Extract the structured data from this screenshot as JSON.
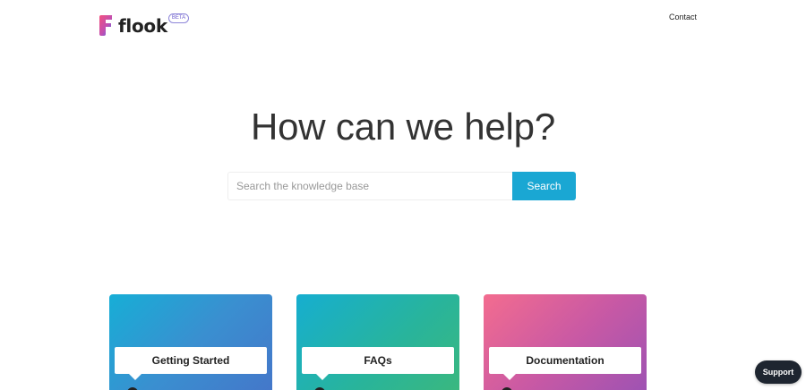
{
  "header": {
    "logo_text": "flook",
    "beta_label": "BETA",
    "contact_label": "Contact"
  },
  "hero": {
    "title": "How can we help?"
  },
  "search": {
    "placeholder": "Search the knowledge base",
    "value": "",
    "button_label": "Search"
  },
  "cards": [
    {
      "label": "Getting Started"
    },
    {
      "label": "FAQs"
    },
    {
      "label": "Documentation"
    }
  ],
  "support": {
    "label": "Support"
  },
  "colors": {
    "accent": "#1aa7d3",
    "logo_gradient_start": "#f4507e",
    "logo_gradient_end": "#4a6cf0",
    "support_bg": "#1e2530"
  },
  "icons": {
    "logo": "flook-logo-icon"
  }
}
